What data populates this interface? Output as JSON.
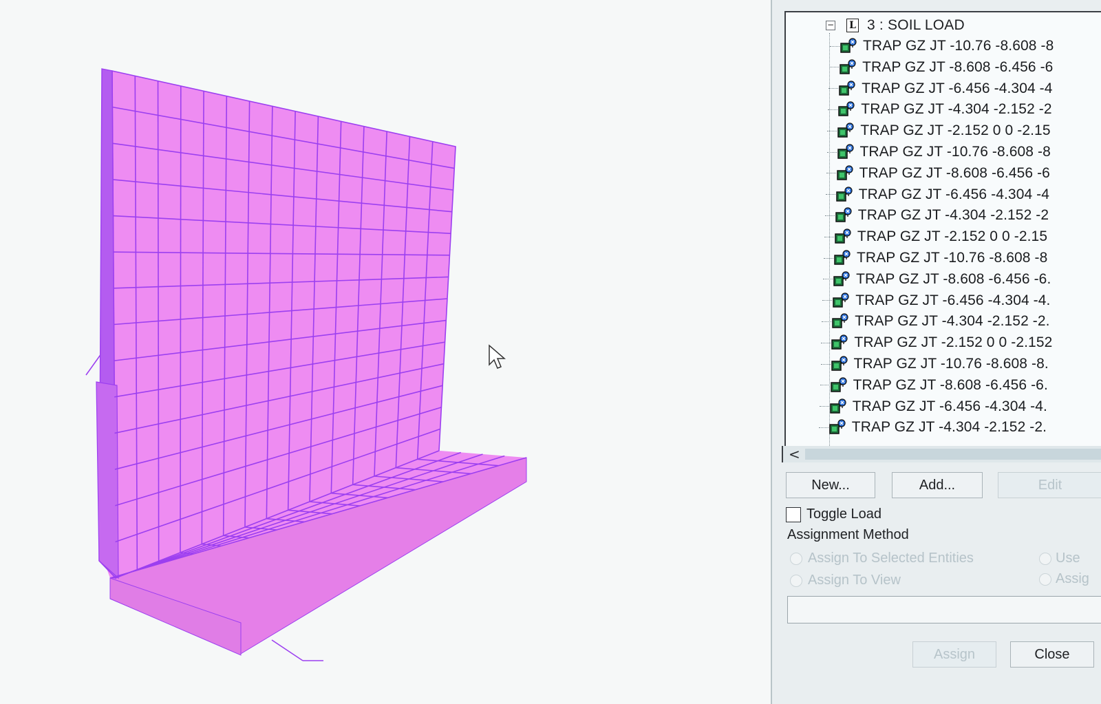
{
  "tree": {
    "expander": "−",
    "root_icon_letter": "L",
    "root_label": "3 : SOIL LOAD",
    "items": [
      "TRAP GZ JT -10.76 -8.608 -8",
      "TRAP GZ JT -8.608 -6.456 -6",
      "TRAP GZ JT -6.456 -4.304 -4",
      "TRAP GZ JT -4.304 -2.152 -2",
      "TRAP GZ JT -2.152 0 0 -2.15",
      "TRAP GZ JT -10.76 -8.608 -8",
      "TRAP GZ JT -8.608 -6.456 -6",
      "TRAP GZ JT -6.456 -4.304 -4",
      "TRAP GZ JT -4.304 -2.152 -2",
      "TRAP GZ JT -2.152 0 0 -2.15",
      "TRAP GZ JT -10.76 -8.608 -8",
      "TRAP GZ JT -8.608 -6.456 -6.",
      "TRAP GZ JT -6.456 -4.304 -4.",
      "TRAP GZ JT -4.304 -2.152 -2.",
      "TRAP GZ JT -2.152 0 0 -2.152",
      "TRAP GZ JT -10.76 -8.608 -8.",
      "TRAP GZ JT -8.608 -6.456 -6.",
      "TRAP GZ JT -6.456 -4.304 -4.",
      "TRAP GZ JT -4.304 -2.152 -2."
    ]
  },
  "scroll": {
    "left_arrow": "<"
  },
  "buttons": {
    "new": "New...",
    "add": "Add...",
    "edit": "Edit",
    "assign": "Assign",
    "close": "Close"
  },
  "toggle_load": {
    "label": "Toggle Load",
    "checked": false
  },
  "assignment": {
    "heading": "Assignment Method",
    "options": [
      "Assign To Selected Entities",
      "Assign To View"
    ],
    "right_options": [
      "Use",
      "Assig"
    ]
  },
  "colors": {
    "mesh_fill": "#ee8cf2",
    "mesh_line": "#9c3ff0",
    "side_fill": "#b45cf0"
  }
}
